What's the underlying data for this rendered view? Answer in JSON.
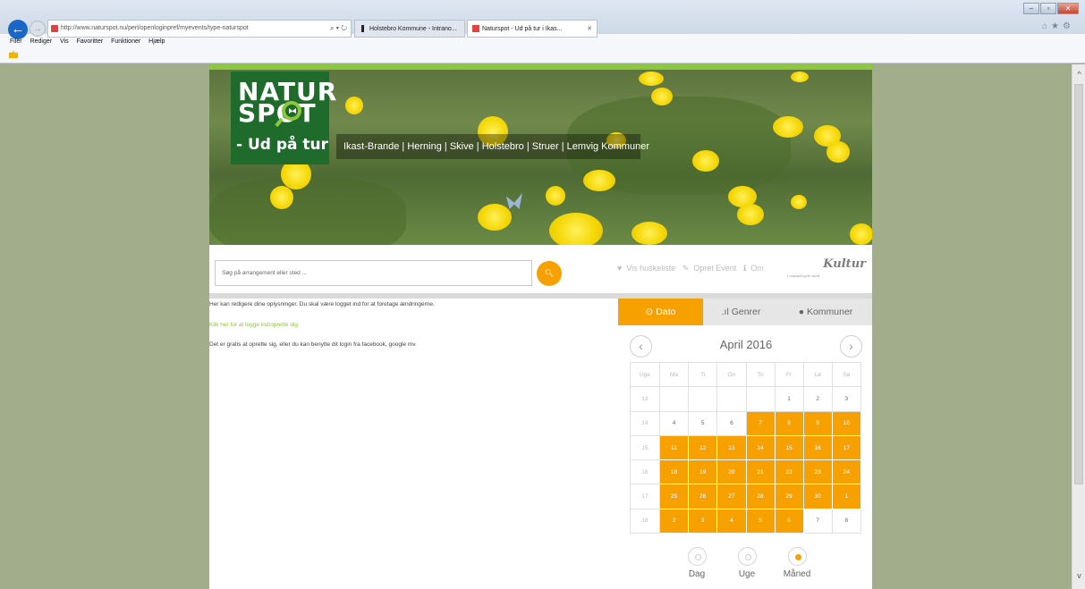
{
  "browser": {
    "url": "http://www.naturspot.nu/perl/openloginpref/myevents/type-naturspot",
    "tabs": [
      {
        "label": "Holstebro Kommune - Intrano..."
      },
      {
        "label": "Naturspot - Ud på tur i Ikas..."
      }
    ],
    "menu": [
      "Filer",
      "Rediger",
      "Vis",
      "Favoritter",
      "Funktioner",
      "Hjælp"
    ]
  },
  "header": {
    "logo_line1": "NATUR",
    "logo_line2": "SPOT",
    "logo_line3": "- Ud på tur",
    "municipalities": "Ikast-Brande | Herning | Skive | Holstebro | Struer | Lemvig Kommuner"
  },
  "search": {
    "placeholder": "Søg på arrangement eller sted ..."
  },
  "toplinks": {
    "huskeliste": "Vis huskeliste",
    "opret": "Opret Event",
    "om": "Om"
  },
  "sponsor": {
    "name": "Kultur",
    "tag": "i samarbejde med"
  },
  "content": {
    "line1": "Her kan redigere dine oplysninger. Du skal være logget ind for at foretage ændringerne.",
    "link": "Klik her for at logge ind/oprette dig",
    "line3": "Det er gratis at oprette sig, eller du kan benytte dit login fra facebook, google mv."
  },
  "calendar_tabs": [
    "Dato",
    "Genrer",
    "Kommuner"
  ],
  "calendar": {
    "month": "April 2016",
    "headers": [
      "Uge",
      "Ma",
      "Ti",
      "On",
      "To",
      "Fr",
      "Lø",
      "Sø"
    ],
    "rows": [
      [
        "13",
        "",
        "",
        "",
        "",
        "1",
        "2",
        "3"
      ],
      [
        "14",
        "4",
        "5",
        "6",
        "7",
        "8",
        "9",
        "10"
      ],
      [
        "15",
        "11",
        "12",
        "13",
        "14",
        "15",
        "16",
        "17"
      ],
      [
        "16",
        "18",
        "19",
        "20",
        "21",
        "22",
        "23",
        "24"
      ],
      [
        "17",
        "25",
        "26",
        "27",
        "28",
        "29",
        "30",
        "1"
      ],
      [
        "18",
        "2",
        "3",
        "4",
        "5",
        "6",
        "7",
        "8"
      ]
    ],
    "highlight_color": "#f7a100",
    "highlighted": [
      [
        1,
        4
      ],
      [
        1,
        5
      ],
      [
        1,
        6
      ],
      [
        1,
        7
      ],
      [
        2,
        1
      ],
      [
        2,
        2
      ],
      [
        2,
        3
      ],
      [
        2,
        4
      ],
      [
        2,
        5
      ],
      [
        2,
        6
      ],
      [
        2,
        7
      ],
      [
        3,
        1
      ],
      [
        3,
        2
      ],
      [
        3,
        3
      ],
      [
        3,
        4
      ],
      [
        3,
        5
      ],
      [
        3,
        6
      ],
      [
        3,
        7
      ],
      [
        4,
        1
      ],
      [
        4,
        2
      ],
      [
        4,
        3
      ],
      [
        4,
        4
      ],
      [
        4,
        5
      ],
      [
        4,
        6
      ],
      [
        4,
        7
      ],
      [
        5,
        1
      ],
      [
        5,
        2
      ],
      [
        5,
        3
      ],
      [
        5,
        4
      ],
      [
        5,
        5
      ]
    ]
  },
  "views": [
    "Dag",
    "Uge",
    "Måned"
  ],
  "view_selected": "Måned"
}
